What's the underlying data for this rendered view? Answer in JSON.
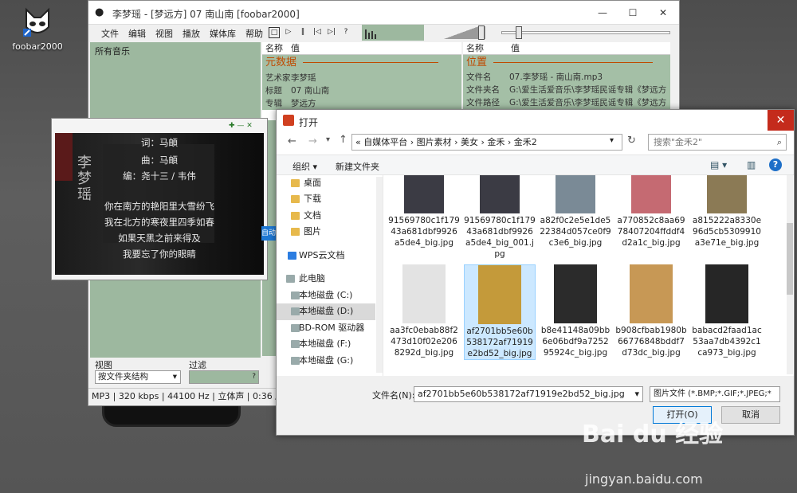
{
  "desktop": {
    "icon_label": "foobar2000"
  },
  "foobar": {
    "title": "李梦瑶 - [梦远方] 07 南山南  [foobar2000]",
    "menu": [
      "文件",
      "编辑",
      "视图",
      "播放",
      "媒体库",
      "帮助"
    ],
    "library_header": "所有音乐",
    "props_left": {
      "col_name": "名称",
      "col_value": "值",
      "group": "元数据",
      "rows": [
        [
          "艺术家",
          "李梦瑶"
        ],
        [
          "标题",
          "07 南山南"
        ],
        [
          "专辑",
          "梦远方"
        ]
      ]
    },
    "props_right": {
      "col_name": "名称",
      "col_value": "值",
      "group": "位置",
      "rows": [
        [
          "文件名",
          "07.李梦瑶 - 南山南.mp3"
        ],
        [
          "文件夹名",
          "G:\\爱生活爱音乐\\李梦瑶民谣专辑《梦远方"
        ],
        [
          "文件路径",
          "G:\\爱生活爱音乐\\李梦瑶民谣专辑《梦远方"
        ]
      ]
    },
    "view_label": "视图",
    "filter_label": "过滤",
    "view_select": "按文件夹结构",
    "filter_btn": "?",
    "status": "MP3 | 320 kbps | 44100 Hz | 立体声 | 0:36 / 5:35"
  },
  "lyrics": {
    "art_text": [
      "李",
      "梦",
      "瑶"
    ],
    "lines": [
      "词：马頔",
      "曲：马頔",
      "编：尧十三 / 韦伟",
      "你在南方的艳阳里大雪纷飞",
      "我在北方的寒夜里四季如春",
      "如果天黑之前来得及",
      "我要忘了你的眼睛"
    ],
    "side_tab": "自动"
  },
  "dialog": {
    "title": "打开",
    "address": "«  自媒体平台  ›  图片素材  ›  美女  ›  金禾  ›  金禾2",
    "search_placeholder": "搜索\"金禾2\"",
    "organize": "组织 ▾",
    "new_folder": "新建文件夹",
    "nav": [
      "桌面",
      "下载",
      "文档",
      "图片",
      "WPS云文档",
      "此电脑",
      "本地磁盘 (C:)",
      "本地磁盘 (D:)",
      "BD-ROM 驱动器",
      "本地磁盘 (F:)",
      "本地磁盘 (G:)"
    ],
    "files": [
      {
        "name": "91569780c1f17943a681dbf9926a5de4_big.jpg",
        "tone": "#3b3b44"
      },
      {
        "name": "91569780c1f17943a681dbf9926a5de4_big_001.jpg",
        "tone": "#3b3b44"
      },
      {
        "name": "a82f0c2e5e1de522384d057ce0f9c3e6_big.jpg",
        "tone": "#7a8a96"
      },
      {
        "name": "a770852c8aa6978407204ffddf4d2a1c_big.jpg",
        "tone": "#c56a72"
      },
      {
        "name": "a815222a8330e96d5cb5309910a3e71e_big.jpg",
        "tone": "#8b7a55"
      },
      {
        "name": "aa3fc0ebab88f2473d10f02e2068292d_big.jpg",
        "tone": "#e3e3e3"
      },
      {
        "name": "af2701bb5e60b538172af71919e2bd52_big.jpg",
        "tone": "#c49a3a"
      },
      {
        "name": "b8e41148a09bb6e06bdf9a725295924c_big.jpg",
        "tone": "#2b2b2b"
      },
      {
        "name": "b908cfbab1980b66776848bddf7d73dc_big.jpg",
        "tone": "#c79855"
      },
      {
        "name": "babacd2faad1ac53aa7db4392c1ca973_big.jpg",
        "tone": "#262626"
      }
    ],
    "filename_label": "文件名(N):",
    "filename_value": "af2701bb5e60b538172af71919e2bd52_big.jpg",
    "filetype": "图片文件 (*.BMP;*.GIF;*.JPEG;*",
    "open_btn": "打开(O)",
    "cancel_btn": "取消"
  },
  "watermark": {
    "logo": "Bai du 经验",
    "url": "jingyan.baidu.com"
  }
}
